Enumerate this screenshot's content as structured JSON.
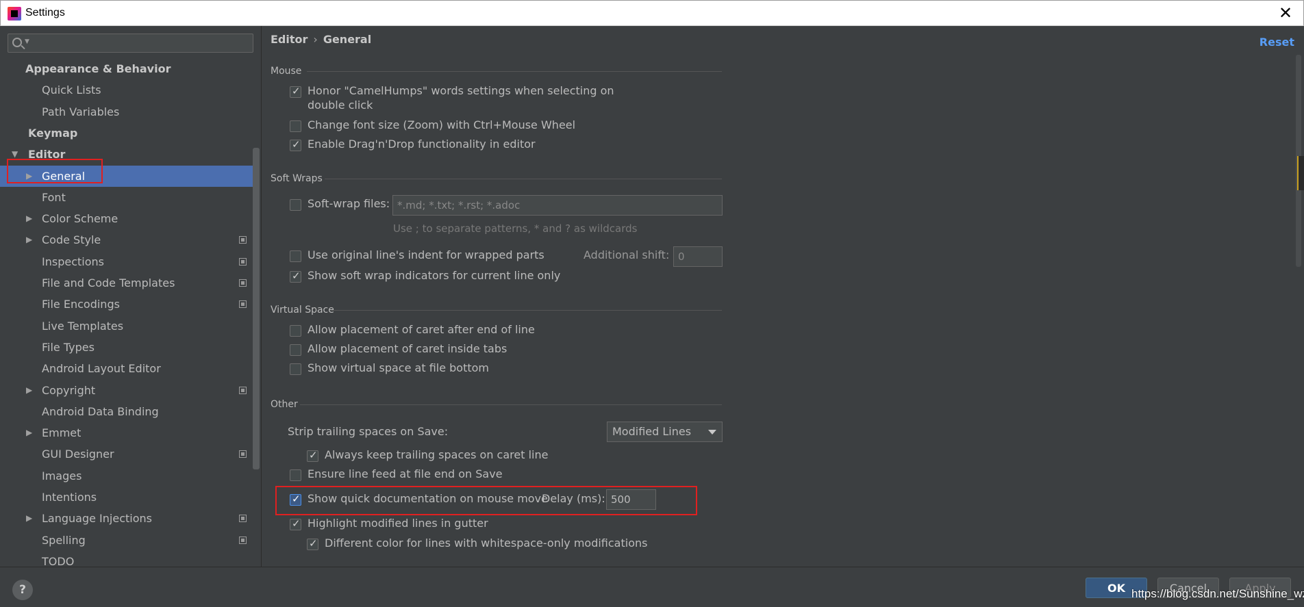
{
  "window": {
    "title": "Settings",
    "close_icon": "close-icon"
  },
  "search": {
    "placeholder": ""
  },
  "sidebar": {
    "items": [
      {
        "label": "Appearance & Behavior",
        "bold": true,
        "indent": 0,
        "arrow": "",
        "copy": false
      },
      {
        "label": "Quick Lists",
        "indent": 2,
        "arrow": "",
        "copy": false
      },
      {
        "label": "Path Variables",
        "indent": 2,
        "arrow": "",
        "copy": false
      },
      {
        "label": "Keymap",
        "bold": true,
        "indent": 1,
        "arrow": "",
        "copy": false
      },
      {
        "label": "Editor",
        "bold": true,
        "indent": 1,
        "arrow": "▼",
        "copy": false
      },
      {
        "label": "General",
        "indent": 2,
        "arrow": "▶",
        "copy": false,
        "selected": true
      },
      {
        "label": "Font",
        "indent": 2,
        "arrow": "",
        "copy": false
      },
      {
        "label": "Color Scheme",
        "indent": 2,
        "arrow": "▶",
        "copy": false
      },
      {
        "label": "Code Style",
        "indent": 2,
        "arrow": "▶",
        "copy": true
      },
      {
        "label": "Inspections",
        "indent": 2,
        "arrow": "",
        "copy": true
      },
      {
        "label": "File and Code Templates",
        "indent": 2,
        "arrow": "",
        "copy": true
      },
      {
        "label": "File Encodings",
        "indent": 2,
        "arrow": "",
        "copy": true
      },
      {
        "label": "Live Templates",
        "indent": 2,
        "arrow": "",
        "copy": false
      },
      {
        "label": "File Types",
        "indent": 2,
        "arrow": "",
        "copy": false
      },
      {
        "label": "Android Layout Editor",
        "indent": 2,
        "arrow": "",
        "copy": false
      },
      {
        "label": "Copyright",
        "indent": 2,
        "arrow": "▶",
        "copy": true
      },
      {
        "label": "Android Data Binding",
        "indent": 2,
        "arrow": "",
        "copy": false
      },
      {
        "label": "Emmet",
        "indent": 2,
        "arrow": "▶",
        "copy": false
      },
      {
        "label": "GUI Designer",
        "indent": 2,
        "arrow": "",
        "copy": true
      },
      {
        "label": "Images",
        "indent": 2,
        "arrow": "",
        "copy": false
      },
      {
        "label": "Intentions",
        "indent": 2,
        "arrow": "",
        "copy": false
      },
      {
        "label": "Language Injections",
        "indent": 2,
        "arrow": "▶",
        "copy": true
      },
      {
        "label": "Spelling",
        "indent": 2,
        "arrow": "",
        "copy": true
      },
      {
        "label": "TODO",
        "indent": 2,
        "arrow": "",
        "copy": false
      }
    ]
  },
  "breadcrumb": {
    "parent": "Editor",
    "sep": "›",
    "current": "General"
  },
  "reset_label": "Reset",
  "sections": {
    "mouse": "Mouse",
    "soft_wraps": "Soft Wraps",
    "virtual_space": "Virtual Space",
    "other": "Other"
  },
  "options": {
    "camelhumps_line1": "Honor \"CamelHumps\" words settings when selecting on",
    "camelhumps_line2": "double click",
    "zoom": "Change font size (Zoom) with Ctrl+Mouse Wheel",
    "dragdrop": "Enable Drag'n'Drop functionality in editor",
    "softwrap_files": "Soft-wrap files:",
    "softwrap_value": "*.md; *.txt; *.rst; *.adoc",
    "softwrap_hint": "Use ; to separate patterns, * and ? as wildcards",
    "original_indent": "Use original line's indent for wrapped parts",
    "additional_shift": "Additional shift:",
    "additional_shift_value": "0",
    "soft_wrap_indicators": "Show soft wrap indicators for current line only",
    "caret_after_end": "Allow placement of caret after end of line",
    "caret_inside_tabs": "Allow placement of caret inside tabs",
    "virtual_space_bottom": "Show virtual space at file bottom",
    "strip_trailing": "Strip trailing spaces on Save:",
    "strip_trailing_value": "Modified Lines",
    "keep_trailing": "Always keep trailing spaces on caret line",
    "line_feed": "Ensure line feed at file end on Save",
    "quick_doc": "Show quick documentation on mouse move",
    "delay_label": "Delay (ms):",
    "delay_value": "500",
    "highlight_modified": "Highlight modified lines in gutter",
    "whitespace_color": "Different color for lines with whitespace-only modifications"
  },
  "footer": {
    "help": "?",
    "ok": "OK",
    "cancel": "Cancel",
    "apply": "Apply",
    "watermark": "https://blog.csdn.net/Sunshine_wz"
  },
  "colors": {
    "selection": "#4b6eaf",
    "highlight_box": "#e02020",
    "link": "#589df6"
  }
}
